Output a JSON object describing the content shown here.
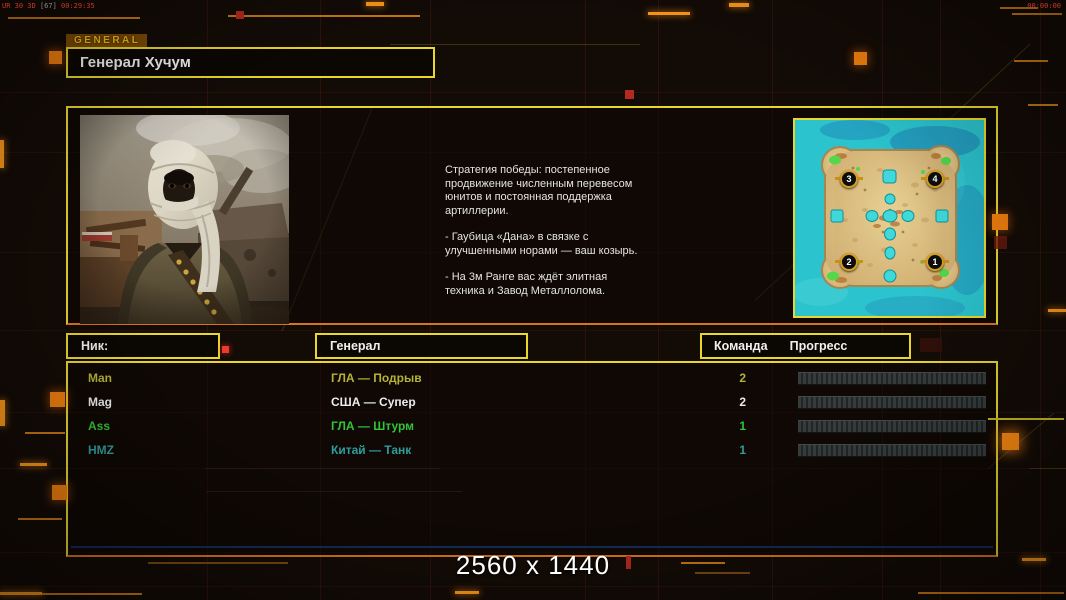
{
  "hud": {
    "perf_main": "UR 30 3D",
    "perf_frame": "[67]",
    "perf_time": "00:29:35",
    "match_timer": "00:00:00"
  },
  "header": {
    "tab_label": "GENERAL",
    "general_name": "Генерал Хучум"
  },
  "briefing": {
    "paragraphs": [
      "Стратегия победы: постепенное продвижение численным перевесом юнитов и постоянная поддержка артиллерии.",
      "- Гаубица «Дана» в связке с улучшенными норами — ваш козырь.",
      "- На 3м Ранге вас ждёт элитная техника и Завод Металлолома."
    ]
  },
  "minimap": {
    "markers": [
      "3",
      "4",
      "2",
      "1"
    ]
  },
  "lobby": {
    "headers": {
      "nick": "Ник:",
      "general": "Генерал",
      "team": "Команда",
      "progress": "Прогресс"
    },
    "players": [
      {
        "nick": "Man",
        "general": "ГЛА — Подрыв",
        "team": "2",
        "color": "#b5b237"
      },
      {
        "nick": "Mag",
        "general": "США — Супер",
        "team": "2",
        "color": "#ececec"
      },
      {
        "nick": "Ass",
        "general": "ГЛА — Штурм",
        "team": "1",
        "color": "#33c433"
      },
      {
        "nick": "HMZ",
        "general": "Китай — Танк",
        "team": "1",
        "color": "#2f9d9d"
      }
    ]
  },
  "footer": {
    "resolution_label": "2560 x 1440"
  },
  "colors": {
    "panel_border": "#ead72b",
    "panel_border_bottom": "#d8741c",
    "accent_orange": "#f48a10",
    "accent_red": "#c8342a"
  }
}
